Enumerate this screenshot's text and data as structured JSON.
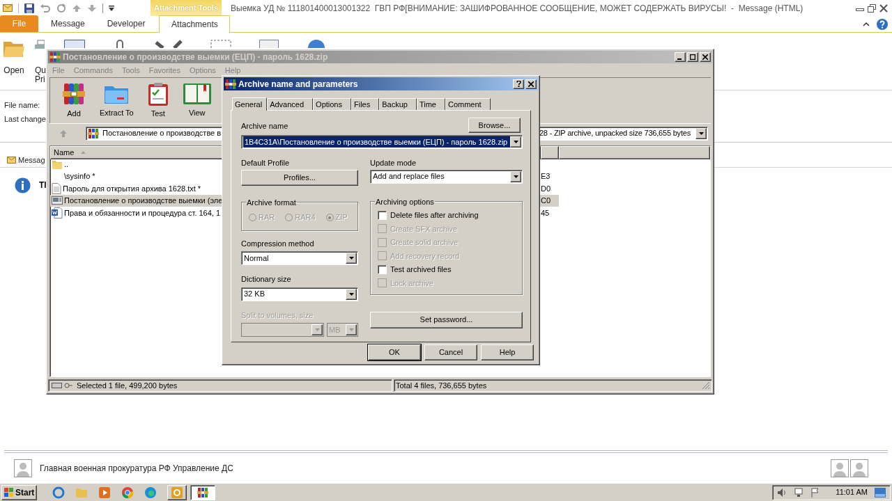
{
  "outlook": {
    "title": "Выемка УД № 111801400013001322  ГВП РФ[ВНИМАНИЕ: ЗАШИФРОВАННОЕ СООБЩЕНИЕ, МОЖЕТ СОДЕРЖАТЬ ВИРУСЫ!  -  Message (HTML)",
    "contextual_tab": "Attachment Tools",
    "tabs": [
      {
        "label": "File",
        "kind": "backstage",
        "selected": false
      },
      {
        "label": "Message",
        "kind": "tab",
        "selected": false
      },
      {
        "label": "Developer",
        "kind": "tab",
        "selected": false
      },
      {
        "label": "Attachments",
        "kind": "tab",
        "selected": true
      }
    ],
    "ribbon_buttons": [
      {
        "kind": "open",
        "lines": [
          "Open"
        ]
      },
      {
        "kind": "print",
        "lines": [
          "Qu",
          "Pri"
        ]
      }
    ],
    "header_labels": [
      "File name:",
      "Last change"
    ],
    "message_tab": "Messag",
    "info_text": "Tl",
    "sender": "Главная военная прокуратура РФ Управление ДС"
  },
  "winrar": {
    "title": "Постановление о производстве выемки (ЕЦП) - пароль 1628.zip",
    "menu": [
      "File",
      "Commands",
      "Tools",
      "Favorites",
      "Options",
      "Help"
    ],
    "toolbar": [
      {
        "kind": "add",
        "label": "Add"
      },
      {
        "kind": "extract",
        "label": "Extract To"
      },
      {
        "kind": "test",
        "label": "Test"
      },
      {
        "kind": "view",
        "label": "View"
      }
    ],
    "address_left": "Постановление о производстве в",
    "address_right": "28 - ZIP archive, unpacked size 736,655 bytes",
    "columns": [
      "Name"
    ],
    "rows": [
      {
        "kind": "parent",
        "name": "..",
        "selected": false
      },
      {
        "kind": "none",
        "name": "\\sysinfo *",
        "column_2": "E3",
        "selected": false
      },
      {
        "kind": "text",
        "name": "Пароль для открытия архива 1628.txt *",
        "column_2": "D0",
        "selected": false
      },
      {
        "kind": "image",
        "name": "Постановление о производстве выемки (эле",
        "column_2": "C0",
        "selected": true
      },
      {
        "kind": "word",
        "name": "Права и обязанности и процедура ст. 164, 1",
        "column_2": "45",
        "selected": false
      }
    ],
    "status": [
      "Selected 1 file, 499,200 bytes",
      "Total 4 files, 736,655 bytes"
    ]
  },
  "dialog": {
    "title": "Archive name and parameters",
    "tabs": [
      {
        "label": "General",
        "selected": true
      },
      {
        "label": "Advanced",
        "selected": false
      },
      {
        "label": "Options",
        "selected": false
      },
      {
        "label": "Files",
        "selected": false
      },
      {
        "label": "Backup",
        "selected": false
      },
      {
        "label": "Time",
        "selected": false
      },
      {
        "label": "Comment",
        "selected": false
      }
    ],
    "archive_name_label": "Archive name",
    "browse": "Browse...",
    "archive_name": "1B4C31A\\Постановление о производстве выемки (ЕЦП) - пароль 1628.zip",
    "default_profile_label": "Default Profile",
    "profiles": "Profiles...",
    "update_mode_label": "Update mode",
    "update_mode": "Add and replace files",
    "archive_format": {
      "label": "Archive format",
      "disabled": true,
      "options": [
        {
          "label": "RAR",
          "selected": false
        },
        {
          "label": "RAR4",
          "selected": false
        },
        {
          "label": "ZIP",
          "selected": true
        }
      ]
    },
    "compression_label": "Compression method",
    "compression": "Normal",
    "dictionary_label": "Dictionary size",
    "dictionary": "32 KB",
    "split": {
      "label": "Split to volumes, size",
      "unit": "MB",
      "disabled": true
    },
    "options": {
      "label": "Archiving options",
      "items": [
        {
          "label": "Delete files after archiving",
          "checked": false,
          "disabled": false
        },
        {
          "label": "Create SFX archive",
          "checked": false,
          "disabled": true
        },
        {
          "label": "Create solid archive",
          "checked": false,
          "disabled": true
        },
        {
          "label": "Add recovery record",
          "checked": false,
          "disabled": true
        },
        {
          "label": "Test archived files",
          "checked": false,
          "disabled": false
        },
        {
          "label": "Lock archive",
          "checked": false,
          "disabled": true
        }
      ]
    },
    "set_password": "Set password...",
    "buttons": [
      {
        "label": "OK",
        "default": true
      },
      {
        "label": "Cancel",
        "default": false
      },
      {
        "label": "Help",
        "default": false
      }
    ]
  },
  "taskbar": {
    "start": "Start",
    "clock": "11:01 AM"
  }
}
